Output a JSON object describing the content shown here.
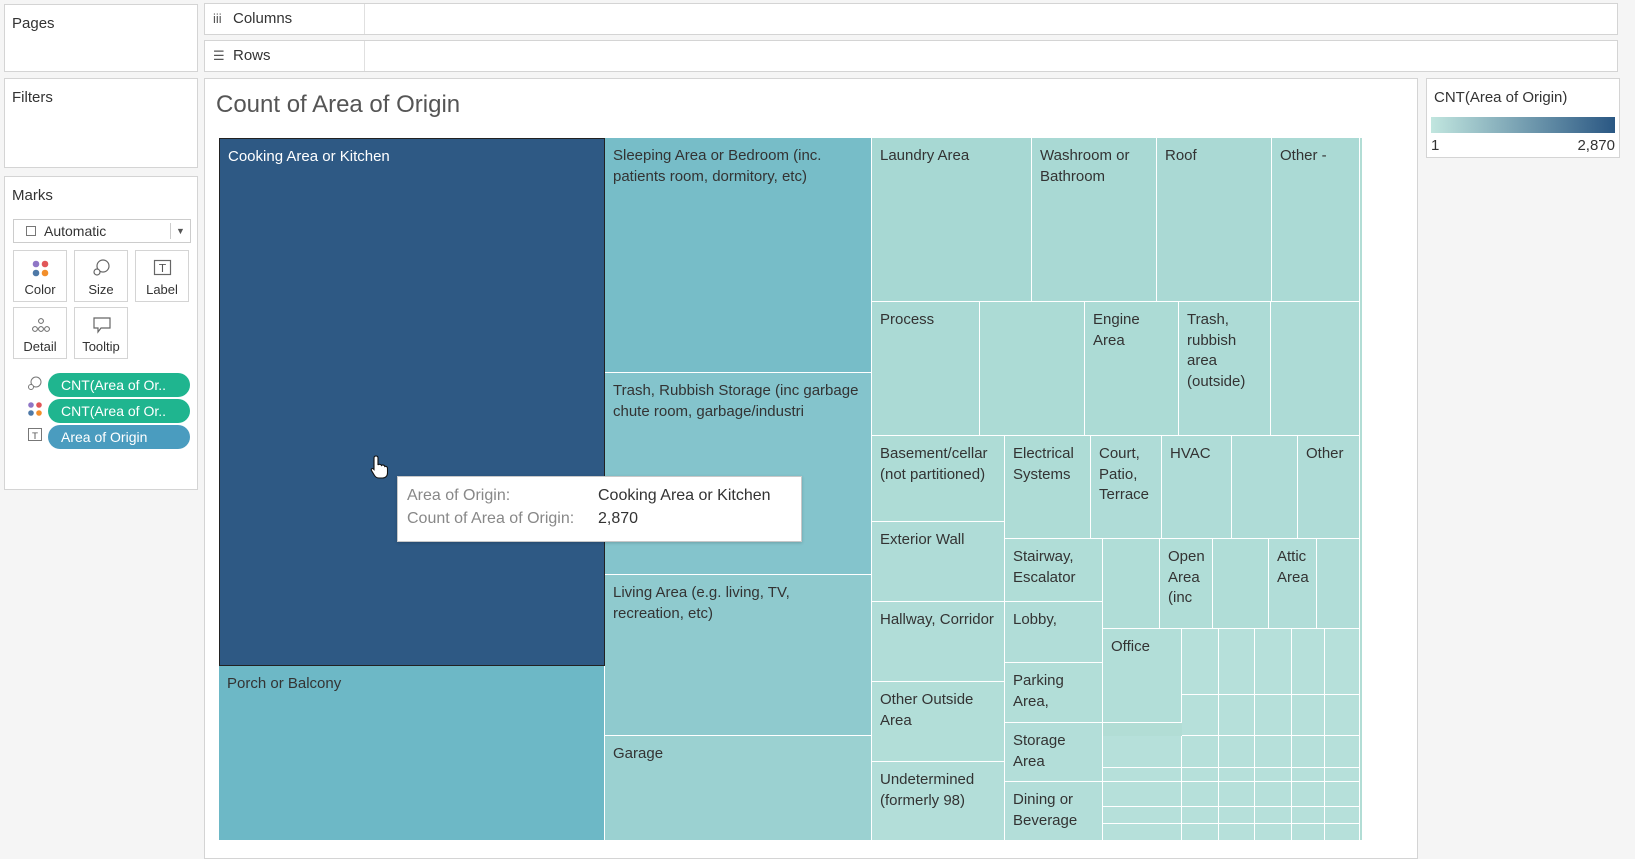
{
  "shelves": {
    "pages_label": "Pages",
    "columns_label": "Columns",
    "rows_label": "Rows",
    "filters_label": "Filters"
  },
  "marks": {
    "title": "Marks",
    "type_value": "Automatic",
    "buttons": [
      "Color",
      "Size",
      "Label",
      "Detail",
      "Tooltip"
    ],
    "pills": [
      "CNT(Area of Or..",
      "CNT(Area of Or..",
      "Area of Origin"
    ]
  },
  "viz": {
    "title": "Count of Area of Origin"
  },
  "legend": {
    "title": "CNT(Area of Origin)",
    "min": "1",
    "max": "2,870",
    "color_low": "#c1e6df",
    "color_high": "#2a5783"
  },
  "tooltip": {
    "key1": "Area of Origin:",
    "val1": "Cooking Area or Kitchen",
    "key2": "Count of Area of Origin:",
    "val2": "2,870"
  },
  "treemap": {
    "labels": [
      "Cooking Area or Kitchen",
      "Porch or Balcony",
      "Sleeping Area or Bedroom (inc. patients room, dormitory, etc)",
      "Trash, Rubbish Storage (inc garbage chute room, garbage/industri",
      "Living Area (e.g. living, TV, recreation, etc)",
      "Garage",
      "Laundry Area",
      "Washroom or Bathroom",
      "Roof",
      "Other -",
      "Process",
      "Engine Area",
      "Trash, rubbish area (outside)",
      "Basement/cellar (not partitioned)",
      "Electrical Systems",
      "Court, Patio, Terrace",
      "HVAC",
      "Other",
      "Exterior Wall",
      "Stairway, Escalator",
      "Open Area (inc",
      "Attic Area",
      "Hallway, Corridor",
      "Lobby,",
      "Other Outside Area",
      "Parking Area,",
      "Office",
      "Storage Area",
      "Undetermined (formerly 98)",
      "Dining or Beverage"
    ]
  }
}
